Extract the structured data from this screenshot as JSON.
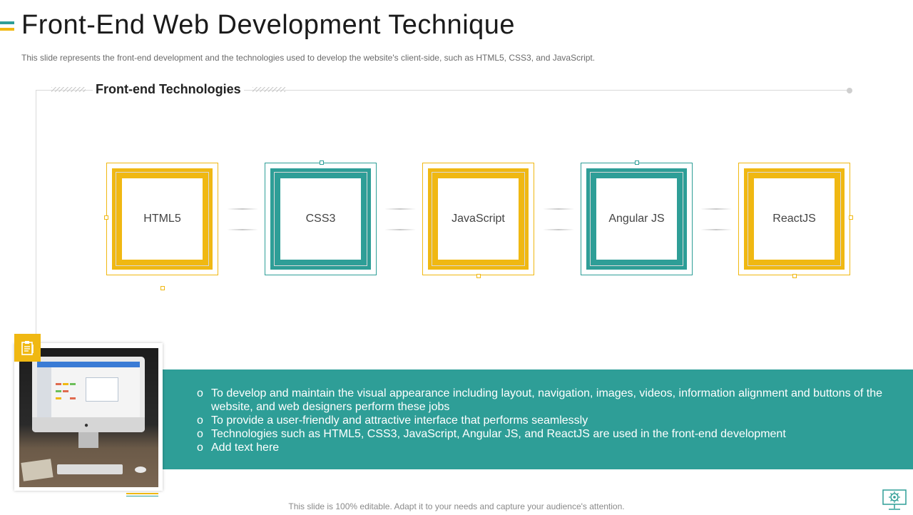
{
  "slide": {
    "title": "Front-End Web Development Technique",
    "subtitle": "This slide represents the front-end  development  and the technologies used to develop  the website's client-side, such as HTML5,  CSS3, and JavaScript.",
    "section_heading": "Front-end Technologies",
    "footer": "This slide is 100% editable. Adapt it to your needs and capture your audience's attention."
  },
  "colors": {
    "teal": "#2e9e97",
    "yellow": "#f0b812",
    "frame": "#d9d9d9"
  },
  "technologies": [
    {
      "label": "HTML5",
      "color": "yellow"
    },
    {
      "label": "CSS3",
      "color": "teal"
    },
    {
      "label": "JavaScript",
      "color": "yellow"
    },
    {
      "label": "Angular JS",
      "color": "teal"
    },
    {
      "label": "ReactJS",
      "color": "yellow"
    }
  ],
  "info": {
    "bullet_glyph": "o",
    "items": [
      "To develop and maintain the visual appearance including layout, navigation, images, videos, information alignment and buttons of the website, and web designers perform these jobs",
      "To provide a user-friendly  and attractive interface that performs seamlessly",
      "Technologies such as HTML5, CSS3, JavaScript, Angular JS, and ReactJS are used in the front-end  development",
      "Add text here"
    ]
  },
  "icons": {
    "badge": "clipboard-icon",
    "photo": "desktop-computer-photo",
    "corner": "monitor-gear-icon"
  }
}
